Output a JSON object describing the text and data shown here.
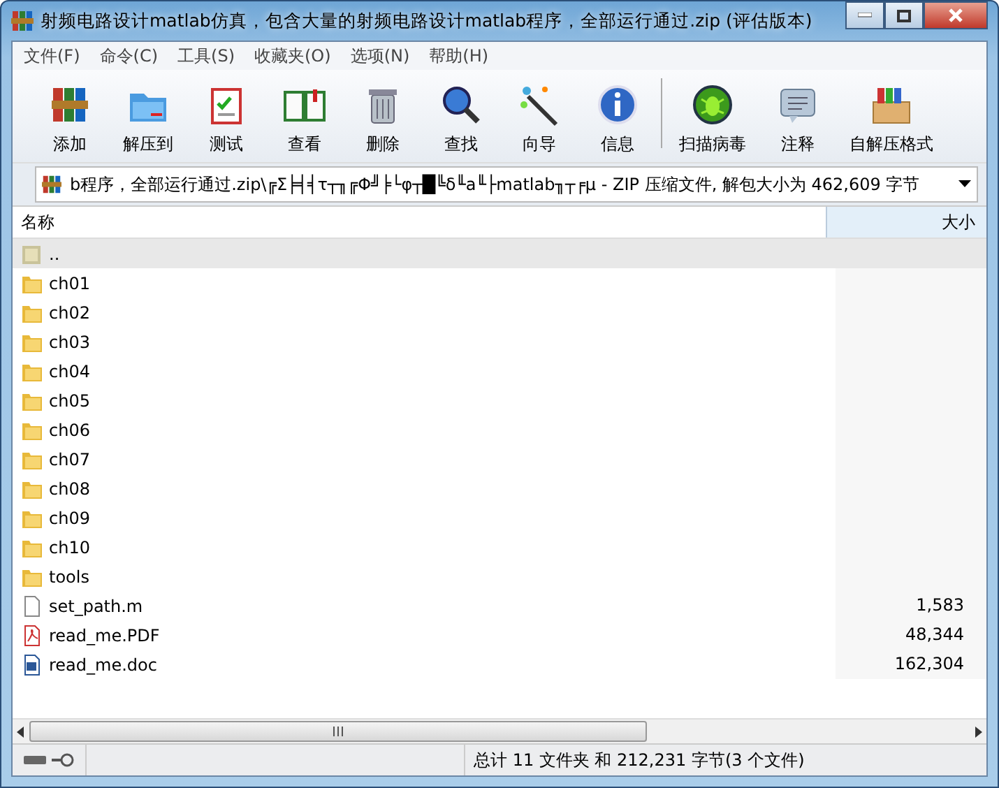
{
  "window": {
    "title": "射频电路设计matlab仿真，包含大量的射频电路设计matlab程序，全部运行通过.zip (评估版本)"
  },
  "menu": [
    "文件(F)",
    "命令(C)",
    "工具(S)",
    "收藏夹(O)",
    "选项(N)",
    "帮助(H)"
  ],
  "toolbar": [
    {
      "label": "添加"
    },
    {
      "label": "解压到"
    },
    {
      "label": "测试"
    },
    {
      "label": "查看"
    },
    {
      "label": "删除"
    },
    {
      "label": "查找"
    },
    {
      "label": "向导"
    },
    {
      "label": "信息"
    },
    {
      "label": "扫描病毒"
    },
    {
      "label": "注释"
    },
    {
      "label": "自解压格式"
    }
  ],
  "path_bar": {
    "value": "b程序，全部运行通过.zip\\╔Σ╞╡╡τ┬╖╔Φ╝╞└φ┬█╚δ╙a╙├matlab╖┬╒µ - ZIP 压缩文件, 解包大小为 462,609 字节"
  },
  "table": {
    "columns": [
      "名称",
      "大小"
    ],
    "rows": [
      {
        "kind": "parent",
        "name": "..",
        "size": "",
        "selected": true
      },
      {
        "kind": "folder",
        "name": "ch01",
        "selected": false
      },
      {
        "kind": "folder",
        "name": "ch02",
        "selected": false
      },
      {
        "kind": "folder",
        "name": "ch03",
        "selected": false
      },
      {
        "kind": "folder",
        "name": "ch04",
        "selected": false
      },
      {
        "kind": "folder",
        "name": "ch05",
        "selected": false
      },
      {
        "kind": "folder",
        "name": "ch06",
        "selected": false
      },
      {
        "kind": "folder",
        "name": "ch07",
        "selected": false
      },
      {
        "kind": "folder",
        "name": "ch08",
        "selected": false
      },
      {
        "kind": "folder",
        "name": "ch09",
        "selected": false
      },
      {
        "kind": "folder",
        "name": "ch10",
        "selected": false
      },
      {
        "kind": "folder",
        "name": "tools",
        "selected": false
      },
      {
        "kind": "file",
        "name": "set_path.m",
        "size": "1,583",
        "selected": false
      },
      {
        "kind": "pdf",
        "name": "read_me.PDF",
        "size": "48,344",
        "selected": false
      },
      {
        "kind": "doc",
        "name": "read_me.doc",
        "size": "162,304",
        "selected": false
      }
    ]
  },
  "status_bar": {
    "text": "总计 11 文件夹 和 212,231 字节(3 个文件)"
  }
}
